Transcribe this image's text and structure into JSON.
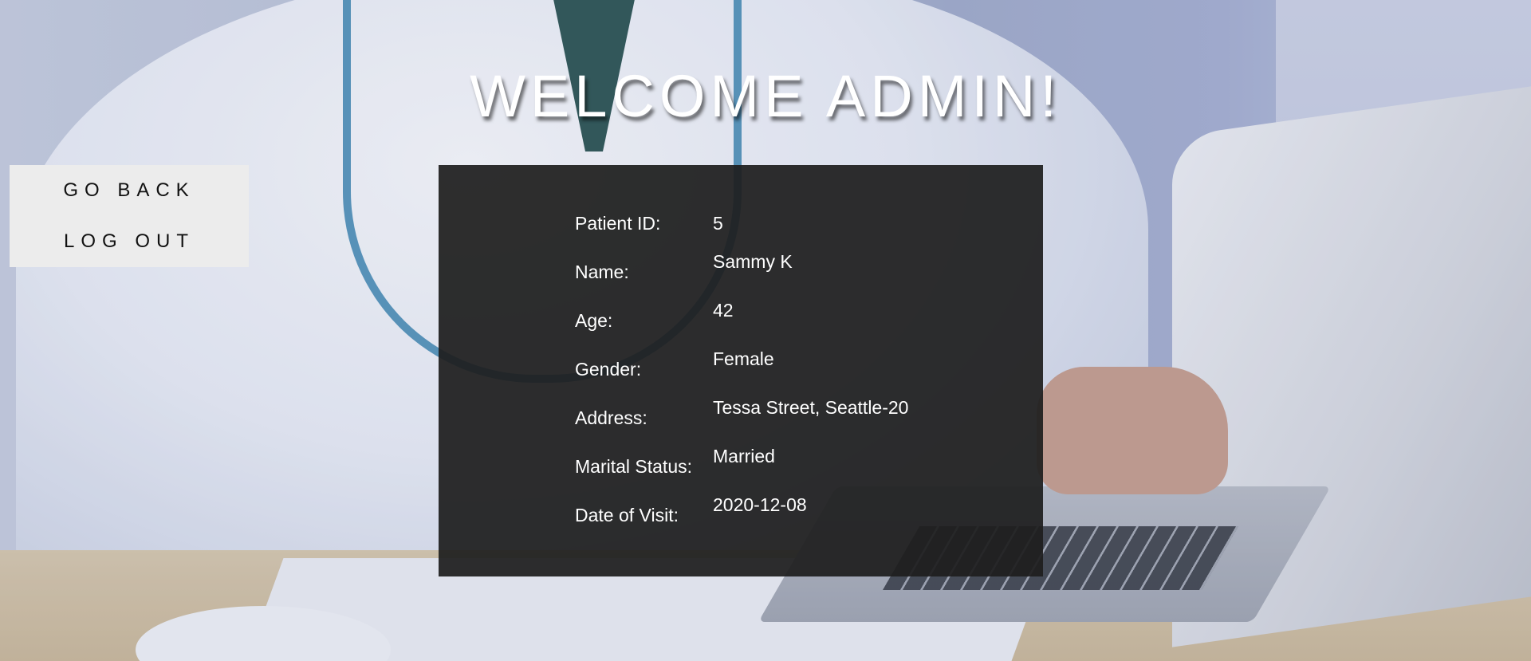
{
  "header": {
    "title": "WELCOME ADMIN!"
  },
  "nav": {
    "items": [
      {
        "label": "GO BACK"
      },
      {
        "label": "LOG OUT"
      }
    ]
  },
  "patient": {
    "fields": [
      {
        "label": "Patient ID:",
        "value": "5"
      },
      {
        "label": "Name:",
        "value": "Sammy K"
      },
      {
        "label": "Age:",
        "value": "42"
      },
      {
        "label": "Gender:",
        "value": "Female"
      },
      {
        "label": "Address:",
        "value": "Tessa Street, Seattle-20"
      },
      {
        "label": "Marital Status:",
        "value": "Married"
      },
      {
        "label": "Date of Visit:",
        "value": "2020-12-08"
      }
    ]
  }
}
